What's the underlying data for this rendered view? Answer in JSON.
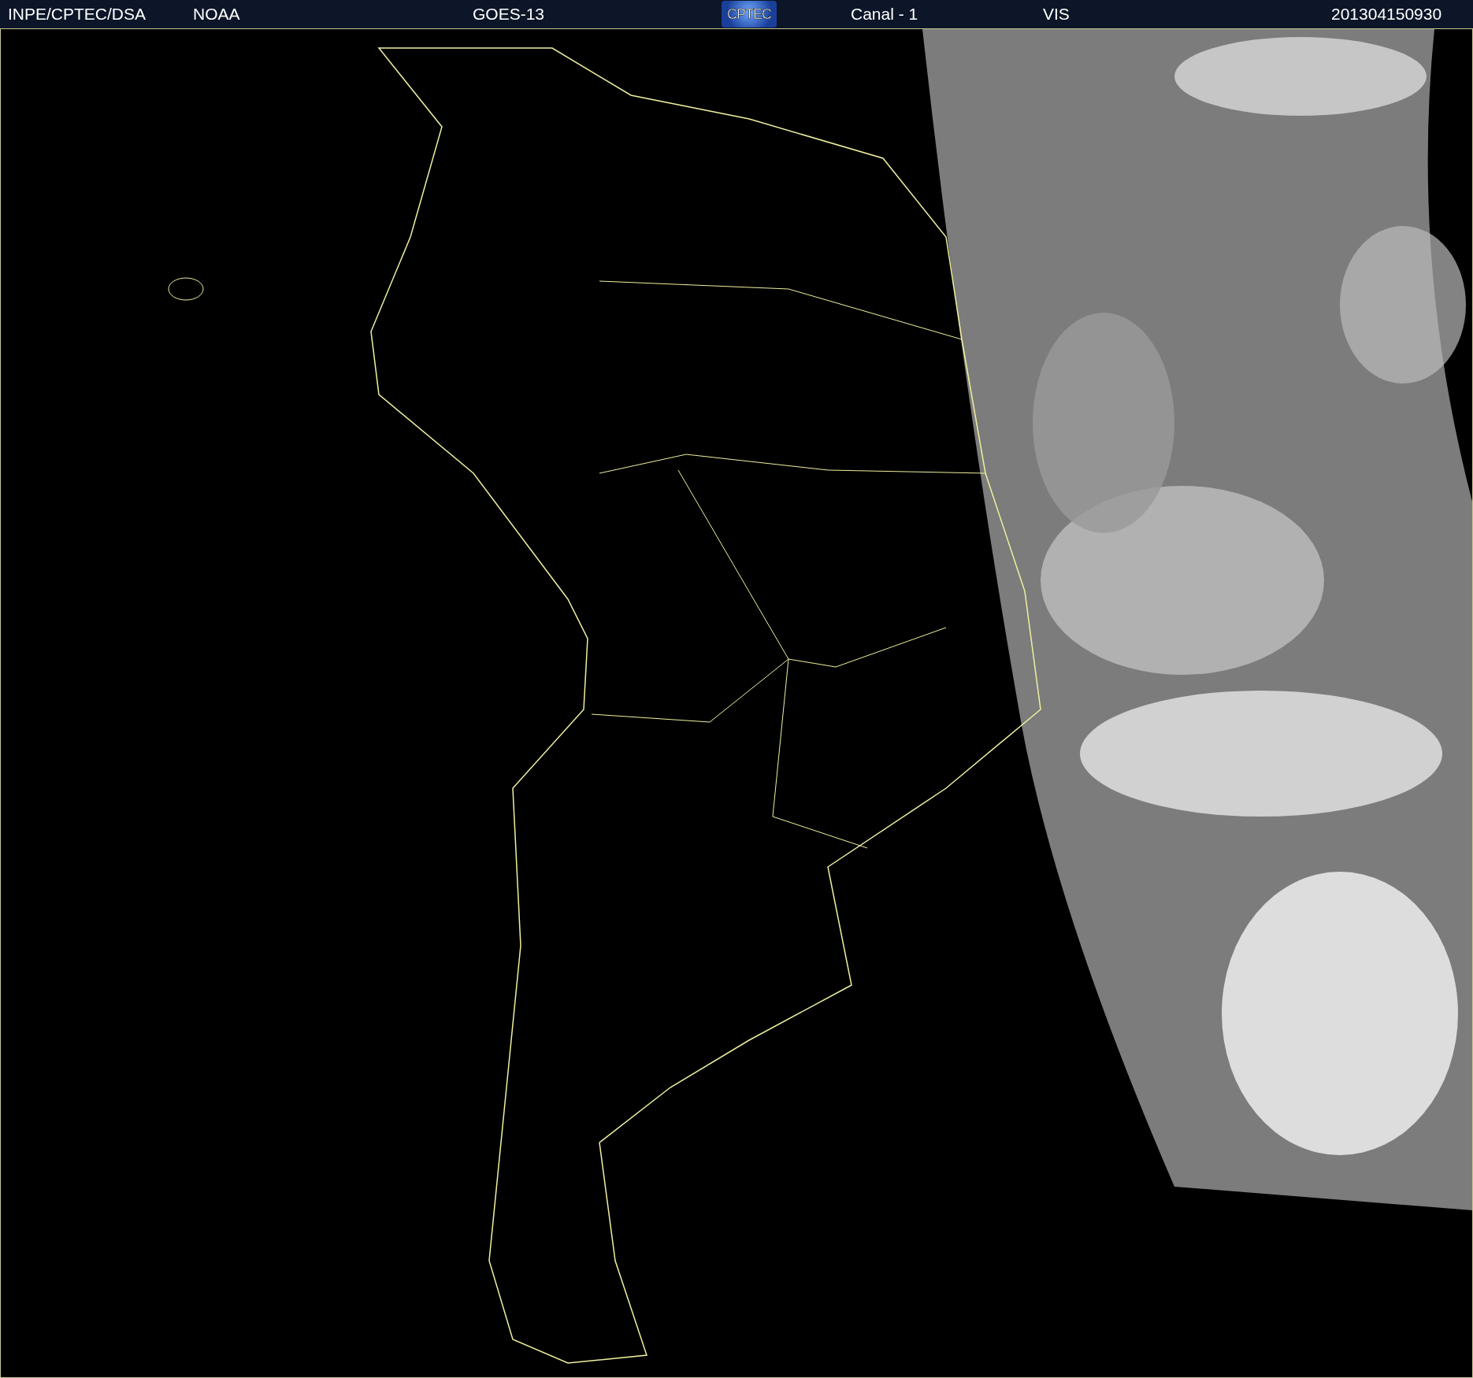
{
  "header": {
    "source": "INPE/CPTEC/DSA",
    "agency": "NOAA",
    "satellite": "GOES-13",
    "logo": "CPTEC",
    "channel": "Canal - 1",
    "band": "VIS",
    "timestamp": "201304150930"
  }
}
